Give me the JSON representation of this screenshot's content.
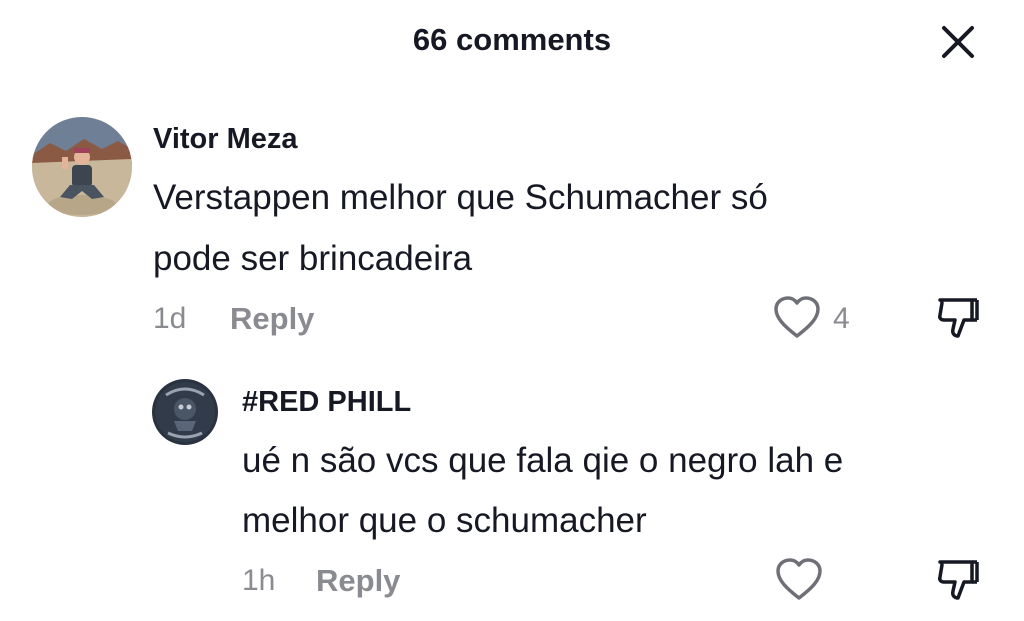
{
  "header": {
    "title": "66 comments",
    "close_icon": "close-icon"
  },
  "comments": [
    {
      "username": "Vitor Meza",
      "text_line1": "Verstappen melhor que Schumacher só",
      "text_line2": "pode ser brincadeira",
      "time": "1d",
      "reply_label": "Reply",
      "like_count": "4",
      "like_icon": "heart-outline-icon",
      "dislike_icon": "thumbs-down-icon",
      "avatar": "user-avatar-photo"
    },
    {
      "username": "#RED PHILL",
      "text_line1": "ué n são vcs que fala qie o negro lah e",
      "text_line2": "melhor que o schumacher",
      "time": "1h",
      "reply_label": "Reply",
      "like_count": "",
      "like_icon": "heart-outline-icon",
      "dislike_icon": "thumbs-down-icon",
      "avatar": "user-avatar-dark-emblem"
    }
  ],
  "colors": {
    "primary_text": "#161823",
    "secondary_text": "#8a8b91",
    "background": "#ffffff"
  }
}
